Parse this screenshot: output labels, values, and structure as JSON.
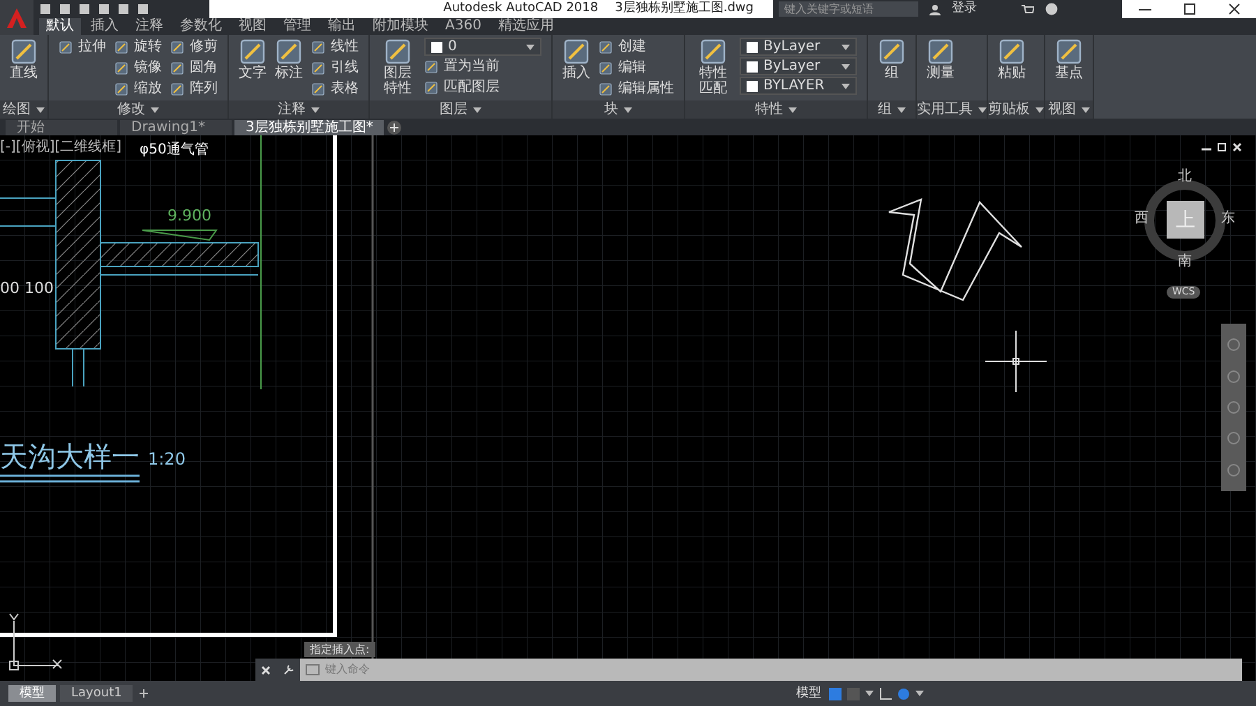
{
  "title_bar": {
    "app_title": "Autodesk AutoCAD 2018",
    "file_name": "3层独栋别墅施工图.dwg",
    "search": {
      "placeholder": "键入关键字或短语"
    },
    "sign_in": "登录"
  },
  "ribbon_tabs": [
    {
      "label": "默认",
      "selected": true
    },
    {
      "label": "插入",
      "selected": false
    },
    {
      "label": "注释",
      "selected": false
    },
    {
      "label": "参数化",
      "selected": false
    },
    {
      "label": "视图",
      "selected": false
    },
    {
      "label": "管理",
      "selected": false
    },
    {
      "label": "输出",
      "selected": false
    },
    {
      "label": "附加模块",
      "selected": false
    },
    {
      "label": "A360",
      "selected": false
    },
    {
      "label": "精选应用",
      "selected": false
    }
  ],
  "ribbon_panels": [
    {
      "label": "绘图",
      "large": [
        "直线"
      ]
    },
    {
      "label": "修改",
      "columns": [
        [
          {
            "kind": "small",
            "label": "拉伸"
          }
        ],
        [
          {
            "kind": "small",
            "label": "旋转"
          },
          {
            "kind": "small",
            "label": "镜像"
          },
          {
            "kind": "small",
            "label": "缩放"
          }
        ],
        [
          {
            "kind": "small",
            "label": "修剪"
          },
          {
            "kind": "small",
            "label": "圆角"
          },
          {
            "kind": "small",
            "label": "阵列"
          }
        ]
      ]
    },
    {
      "label": "注释",
      "large": [
        "文字",
        "标注"
      ],
      "columns": [
        [
          {
            "kind": "small",
            "label": "线性"
          },
          {
            "kind": "small",
            "label": "引线"
          },
          {
            "kind": "small",
            "label": "表格"
          }
        ]
      ]
    },
    {
      "label": "图层",
      "large": [
        "图层特性"
      ],
      "columns": [
        [
          {
            "kind": "dropdown",
            "label": "0"
          },
          {
            "kind": "small",
            "label": "置为当前"
          },
          {
            "kind": "small",
            "label": "匹配图层"
          }
        ]
      ]
    },
    {
      "label": "块",
      "large": [
        "插入"
      ],
      "columns": [
        [
          {
            "kind": "small",
            "label": "创建"
          },
          {
            "kind": "small",
            "label": "编辑"
          },
          {
            "kind": "small",
            "label": "编辑属性"
          }
        ]
      ]
    },
    {
      "label": "特性",
      "large": [
        "特性匹配"
      ],
      "columns": [
        [
          {
            "kind": "dropdown",
            "label": "ByLayer"
          },
          {
            "kind": "dropdown",
            "label": "ByLayer"
          },
          {
            "kind": "dropdown",
            "label": "BYLAYER"
          }
        ]
      ]
    },
    {
      "label": "组",
      "large": [
        "组"
      ]
    },
    {
      "label": "实用工具",
      "large": [
        "测量"
      ]
    },
    {
      "label": "剪贴板",
      "large": [
        "粘贴"
      ]
    },
    {
      "label": "视图",
      "large": [
        "基点"
      ]
    }
  ],
  "file_tabs": [
    {
      "label": "开始",
      "selected": false
    },
    {
      "label": "Drawing1*",
      "selected": false
    },
    {
      "label": "3层独栋别墅施工图*",
      "selected": true
    }
  ],
  "drawing": {
    "viewport_label": "[-][俯视][二维线框]",
    "pipe_note": "φ50通气管",
    "elevation": "9.900",
    "dimensions": "00 100",
    "detail_title": "天沟大样一",
    "scale": "1:20"
  },
  "view_cube": {
    "north": "北",
    "west": "西",
    "top": "上",
    "east": "东",
    "south": "南",
    "coordinate_system": "WCS"
  },
  "tooltip": "指定插入点:",
  "command_line": {
    "placeholder": "键入命令"
  },
  "layout_tabs": [
    {
      "label": "模型",
      "selected": true
    },
    {
      "label": "Layout1",
      "selected": false
    }
  ],
  "status_bar": {
    "space": "模型"
  }
}
